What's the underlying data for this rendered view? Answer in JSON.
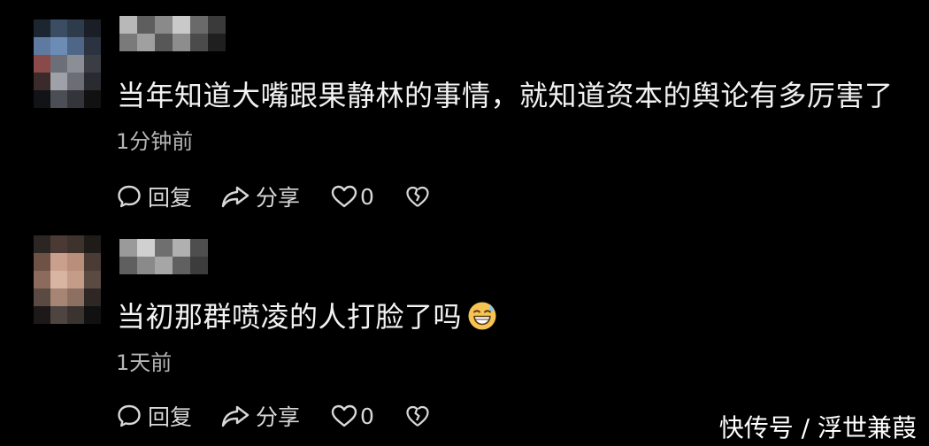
{
  "comments": [
    {
      "text": "当年知道大嘴跟果静林的事情，就知道资本的舆论有多厉害了",
      "time": "1分钟前",
      "reply_label": "回复",
      "share_label": "分享",
      "like_count": "0"
    },
    {
      "text": "当初那群喷凌的人打脸了吗",
      "emoji": "grinning-sweat-emoji",
      "time": "1天前",
      "reply_label": "回复",
      "share_label": "分享",
      "like_count": "0"
    }
  ],
  "watermark": "快传号 / 浮世兼葭",
  "icons": [
    "comment-bubble-icon",
    "share-arrow-icon",
    "heart-icon",
    "broken-heart-icon"
  ],
  "colors": {
    "background": "#000000",
    "text": "#f2f2f2",
    "secondary": "#b5b5b5"
  }
}
